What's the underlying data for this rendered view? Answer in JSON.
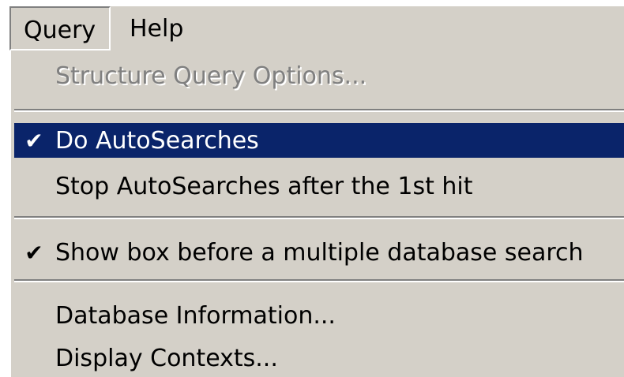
{
  "menubar": {
    "items": [
      {
        "label": "Query",
        "active": true
      },
      {
        "label": "Help",
        "active": false
      }
    ]
  },
  "query_menu": {
    "items": [
      {
        "label": "Structure Query Options...",
        "enabled": false,
        "checked": false
      },
      {
        "label": "Do AutoSearches",
        "enabled": true,
        "checked": true,
        "highlighted": true
      },
      {
        "label": "Stop AutoSearches after the 1st hit",
        "enabled": true,
        "checked": false
      },
      {
        "label": "Show box before a multiple database search",
        "enabled": true,
        "checked": true
      },
      {
        "label": "Database Information...",
        "enabled": true,
        "checked": false
      },
      {
        "label": "Display Contexts...",
        "enabled": true,
        "checked": false
      }
    ],
    "check_glyph": "✔"
  },
  "colors": {
    "menu_bg": "#d4d0c8",
    "highlight_bg": "#0a246a",
    "highlight_text": "#ffffff",
    "disabled_text": "#808080"
  }
}
